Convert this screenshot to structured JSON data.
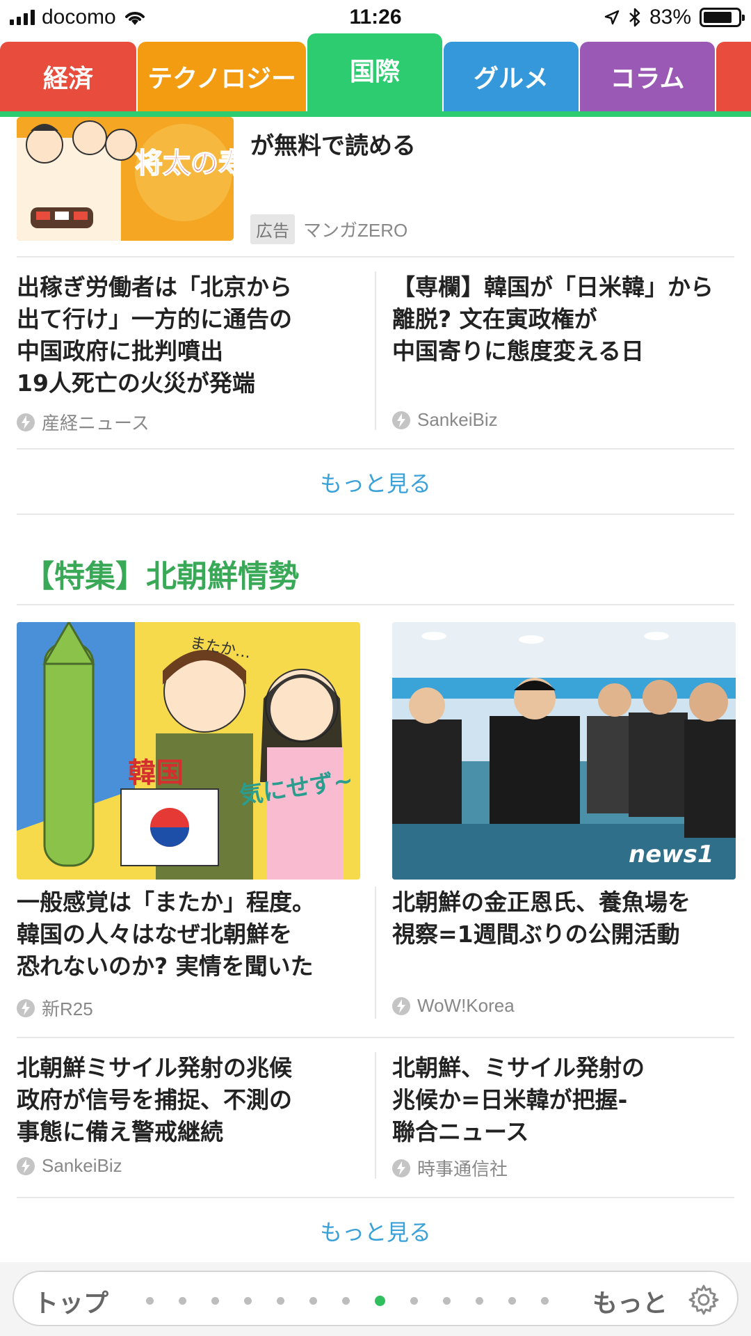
{
  "status_bar": {
    "carrier": "docomo",
    "time": "11:26",
    "battery_percent": "83%",
    "battery_level": 0.83
  },
  "tabs": [
    {
      "label": "経済",
      "color": "#e74c3c",
      "active": false
    },
    {
      "label": "テクノロジー",
      "color": "#f39c12",
      "active": false
    },
    {
      "label": "国際",
      "color": "#2ecc71",
      "active": true
    },
    {
      "label": "グルメ",
      "color": "#3498db",
      "active": false
    },
    {
      "label": "コラム",
      "color": "#9b59b6",
      "active": false
    },
    {
      "label": "",
      "color": "#e74c3c",
      "active": false
    }
  ],
  "ad": {
    "title": "が無料で読める",
    "badge": "広告",
    "source": "マンガZERO"
  },
  "articles_top": [
    {
      "title": "出稼ぎ労働者は「北京から\n出て行け」一方的に通告の\n中国政府に批判噴出\n19人死亡の火災が発端",
      "source": "産経ニュース"
    },
    {
      "title": "【専欄】韓国が「日米韓」から\n離脱? 文在寅政権が\n中国寄りに態度変える日",
      "source": "SankeiBiz"
    }
  ],
  "more_label_1": "もっと見る",
  "section_title": "【特集】北朝鮮情勢",
  "photo_articles": [
    {
      "title": "一般感覚は「またか」程度。\n韓国の人々はなぜ北朝鮮を\n恐れないのか? 実情を聞いた",
      "source": "新R25"
    },
    {
      "title": "北朝鮮の金正恩氏、養魚場を\n視察=1週間ぶりの公開活動",
      "source": "WoW!Korea",
      "watermark": "news1"
    }
  ],
  "articles_bottom": [
    {
      "title": "北朝鮮ミサイル発射の兆候\n政府が信号を捕捉、不測の\n事態に備え警戒継続",
      "source": "SankeiBiz"
    },
    {
      "title": "北朝鮮、ミサイル発射の\n兆候か=日米韓が把握-\n聯合ニュース",
      "source": "時事通信社"
    }
  ],
  "more_label_2": "もっと見る",
  "bottom_bar": {
    "top_label": "トップ",
    "more_label": "もっと",
    "page_count": 13,
    "active_page": 8
  },
  "colors": {
    "accent_green": "#2ecc71",
    "link_blue": "#3aa0d8",
    "section_green": "#3aa957"
  }
}
